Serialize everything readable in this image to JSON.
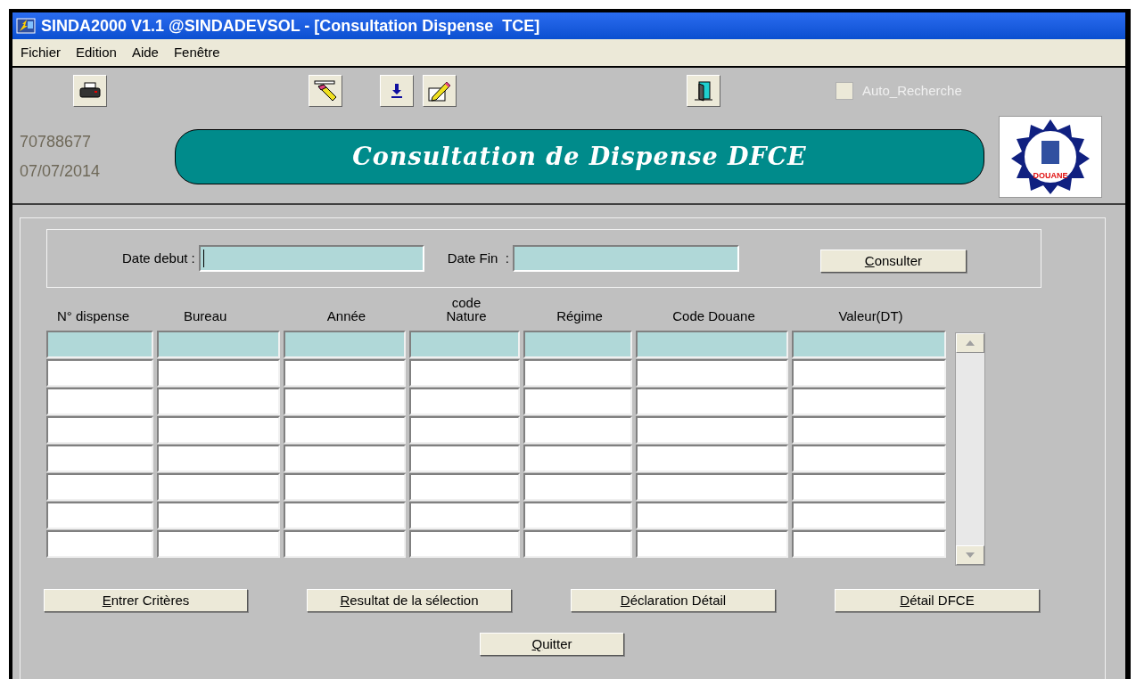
{
  "window": {
    "title": "SINDA2000 V1.1 @SINDADEVSOL - [Consultation Dispense  TCE]"
  },
  "menu": [
    "Fichier",
    "Edition",
    "Aide",
    "Fenêtre"
  ],
  "toolbar": {
    "auto_search": {
      "label": "Auto_Recherche",
      "checked": false,
      "disabled": true
    }
  },
  "user": {
    "id": "70788677",
    "date": "07/07/2014"
  },
  "banner": {
    "title": "Consultation de Dispense DFCE"
  },
  "logo": {
    "text": "DOUANE"
  },
  "criteria": {
    "date_debut": {
      "label": "Date debut :",
      "focused": true
    },
    "date_fin": {
      "label": "Date Fin  :",
      "focused": false
    },
    "button": "Consulter"
  },
  "table": {
    "columns": [
      "N° dispense",
      "Bureau",
      "Année",
      "code Nature",
      "Régime",
      "Code Douane",
      "Valeur(DT)"
    ],
    "rows": [
      {
        "selected": true
      },
      {
        "selected": false
      },
      {
        "selected": false
      },
      {
        "selected": false
      },
      {
        "selected": false
      },
      {
        "selected": false
      },
      {
        "selected": false
      },
      {
        "selected": false
      }
    ]
  },
  "actions": [
    "Entrer Critères",
    "Resultat de la sélection",
    "Déclaration Détail",
    "Détail DFCE"
  ],
  "quit_button": "Quitter"
}
